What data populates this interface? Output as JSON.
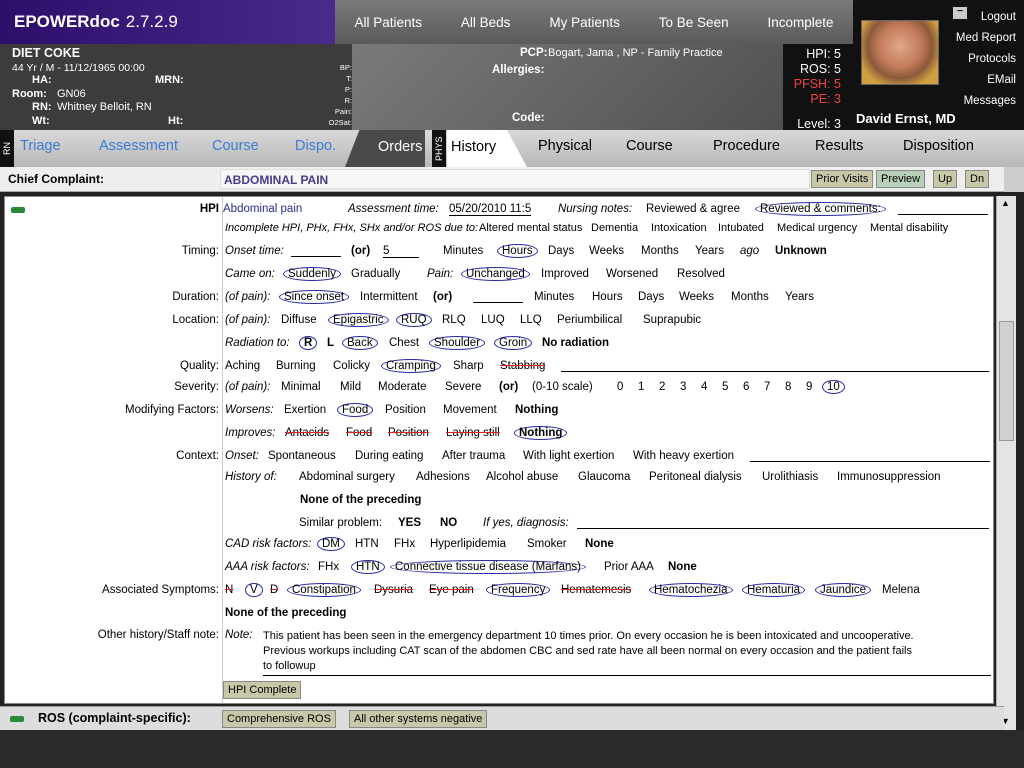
{
  "app": {
    "name": "EPOWERdoc",
    "version": "2.7.2.9"
  },
  "nav": [
    "All Patients",
    "All Beds",
    "My Patients",
    "To Be Seen",
    "Incomplete"
  ],
  "links": [
    "Logout",
    "Med Report",
    "Protocols",
    "EMail",
    "Messages"
  ],
  "patient": {
    "name": "DIET COKE",
    "demo": "44 Yr / M  -  11/12/1965 00:00",
    "ha_label": "HA:",
    "mrn_label": "MRN:",
    "room_label": "Room:",
    "room": "GN06",
    "rn_label": "RN:",
    "rn": "Whitney Belloit, RN",
    "wt_label": "Wt:",
    "ht_label": "Ht:"
  },
  "vitals": [
    "BP:",
    "T:",
    "P:",
    "R:",
    "Pain:",
    "O2Sat:"
  ],
  "pcp_label": "PCP:",
  "pcp": "Bogart, Jama , NP - Family Practice",
  "allergies_label": "Allergies:",
  "code_label": "Code:",
  "levels": {
    "hpi": "HPI:  5",
    "ros": "ROS:  5",
    "pfsh": "PFSH:  5",
    "pe": "PE:  3",
    "level": "Level:  3"
  },
  "doctor": "David Ernst, MD",
  "tabs": {
    "rn_label": "RN",
    "phys_label": "PHYS",
    "rn": [
      "Triage",
      "Assessment",
      "Course",
      "Dispo."
    ],
    "orders": "Orders",
    "phys": [
      "History",
      "Physical",
      "Course",
      "Procedure",
      "Results",
      "Disposition"
    ]
  },
  "cc": {
    "label": "Chief Complaint:",
    "value": "ABDOMINAL PAIN",
    "buttons": [
      "Prior Visits",
      "Preview",
      "Up",
      "Dn"
    ]
  },
  "hpi": {
    "label": "HPI",
    "complaint": "Abdominal pain",
    "atime_label": "Assessment time:",
    "atime": "05/20/2010 11:5",
    "nn_label": "Nursing notes:",
    "nn_opt1": "Reviewed & agree",
    "nn_opt2": "Reviewed & comments:",
    "incomplete": "Incomplete HPI, PHx, FHx, SHx and/or ROS due to:",
    "inc_opts": [
      "Altered mental status",
      "Dementia",
      "Intoxication",
      "Intubated",
      "Medical urgency",
      "Mental disability"
    ]
  },
  "timing": {
    "label": "Timing:",
    "onset_label": "Onset time:",
    "or": "(or)",
    "num": "5",
    "units": [
      "Minutes",
      "Hours",
      "Days",
      "Weeks",
      "Months",
      "Years"
    ],
    "ago": "ago",
    "unknown": "Unknown",
    "came_label": "Came on:",
    "came": [
      "Suddenly",
      "Gradually"
    ],
    "pain_label": "Pain:",
    "pain": [
      "Unchanged",
      "Improved",
      "Worsened",
      "Resolved"
    ]
  },
  "duration": {
    "label": "Duration:",
    "pre": "(of pain):",
    "opts": [
      "Since onset",
      "Intermittent"
    ],
    "or": "(or)",
    "units": [
      "Minutes",
      "Hours",
      "Days",
      "Weeks",
      "Months",
      "Years"
    ]
  },
  "location": {
    "label": "Location:",
    "pre": "(of pain):",
    "opts": [
      "Diffuse",
      "Epigastric",
      "RUQ",
      "RLQ",
      "LUQ",
      "LLQ",
      "Periumbilical",
      "Suprapubic"
    ],
    "rad_label": "Radiation to:",
    "rad": [
      "R",
      "L",
      "Back",
      "Chest",
      "Shoulder",
      "Groin"
    ],
    "no_rad": "No radiation"
  },
  "quality": {
    "label": "Quality:",
    "opts": [
      "Aching",
      "Burning",
      "Colicky",
      "Cramping",
      "Sharp",
      "Stabbing"
    ]
  },
  "severity": {
    "label": "Severity:",
    "pre": "(of pain):",
    "opts": [
      "Minimal",
      "Mild",
      "Moderate",
      "Severe"
    ],
    "or": "(or)",
    "scale": "(0-10 scale)",
    "nums": [
      "0",
      "1",
      "2",
      "3",
      "4",
      "5",
      "6",
      "7",
      "8",
      "9",
      "10"
    ]
  },
  "modifying": {
    "label": "Modifying Factors:",
    "w_label": "Worsens:",
    "w": [
      "Exertion",
      "Food",
      "Position",
      "Movement"
    ],
    "w_nothing": "Nothing",
    "i_label": "Improves:",
    "i": [
      "Antacids",
      "Food",
      "Position",
      "Laying still"
    ],
    "i_nothing": "Nothing"
  },
  "context": {
    "label": "Context:",
    "onset_label": "Onset:",
    "onset": [
      "Spontaneous",
      "During eating",
      "After trauma",
      "With light exertion",
      "With heavy exertion"
    ],
    "hist_label": "History of:",
    "hist": [
      "Abdominal surgery",
      "Adhesions",
      "Alcohol abuse",
      "Glaucoma",
      "Peritoneal dialysis",
      "Urolithiasis",
      "Immunosuppression"
    ],
    "none": "None of the preceding",
    "sim_label": "Similar problem:",
    "yes": "YES",
    "no": "NO",
    "ifyes": "If yes, diagnosis:",
    "cad_label": "CAD risk factors:",
    "cad": [
      "DM",
      "HTN",
      "FHx",
      "Hyperlipidemia",
      "Smoker"
    ],
    "cad_none": "None",
    "aaa_label": "AAA risk factors:",
    "aaa": [
      "FHx",
      "HTN",
      "Connective tissue disease (Marfans)",
      "Prior AAA"
    ],
    "aaa_none": "None"
  },
  "assoc": {
    "label": "Associated Symptoms:",
    "opts": [
      "N",
      "V",
      "D",
      "Constipation",
      "Dysuria",
      "Eye pain",
      "Frequency",
      "Hematemesis",
      "Hematochezia",
      "Hematuria",
      "Jaundice",
      "Melena"
    ],
    "none": "None of the preceding"
  },
  "other": {
    "label": "Other history/Staff note:",
    "note_label": "Note:",
    "note1": "This patient has been seen in the emergency department 10 times prior. On every occasion he is been intoxicated and uncooperative.",
    "note2": "Previous workups including CAT scan of the abdomen CBC and sed rate have all been normal on every occasion and the patient fails",
    "note3": "to followup"
  },
  "hpi_complete": "HPI Complete",
  "ros": {
    "label": "ROS (complaint-specific):",
    "b1": "Comprehensive ROS",
    "b2": "All other systems negative"
  }
}
